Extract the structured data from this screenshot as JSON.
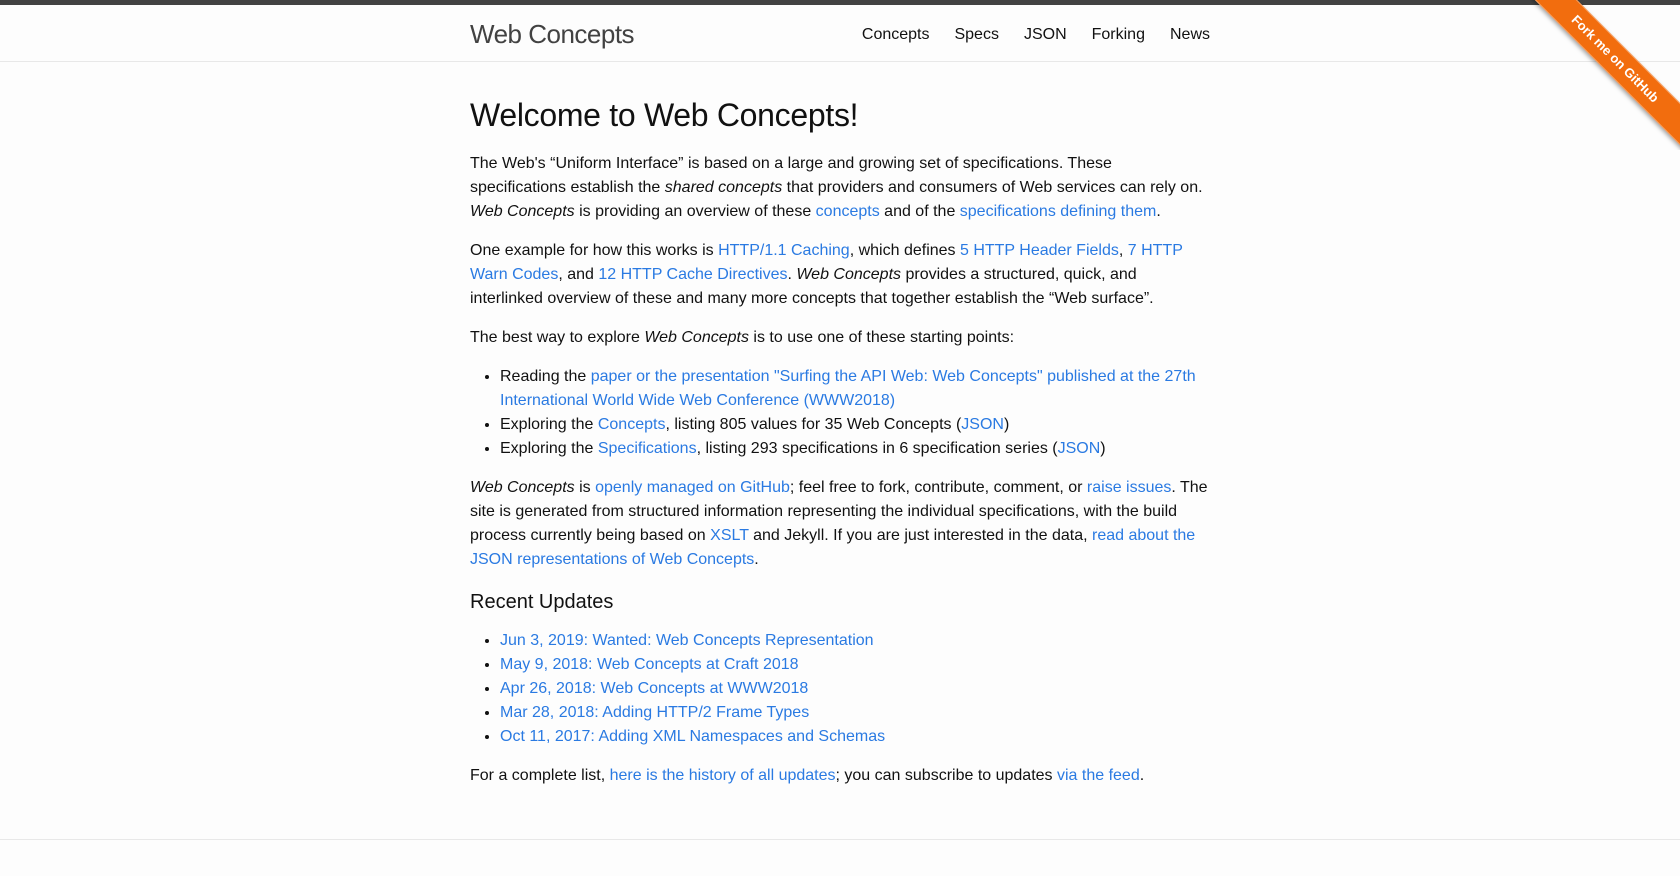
{
  "header": {
    "site_title": "Web Concepts",
    "nav": [
      "Concepts",
      "Specs",
      "JSON",
      "Forking",
      "News"
    ]
  },
  "ribbon": "Fork me on GitHub",
  "main": {
    "title": "Welcome to Web Concepts!",
    "intro": {
      "t1": "The Web's “Uniform Interface” is based on a large and growing set of specifications. These specifications establish the ",
      "em1": "shared concepts",
      "t2": " that providers and consumers of Web services can rely on. ",
      "em2": "Web Concepts",
      "t3": " is providing an overview of these ",
      "link1": "concepts",
      "t4": " and of the ",
      "link2": "specifications defining them",
      "t5": "."
    },
    "example": {
      "t1": "One example for how this works is ",
      "link1": "HTTP/1.1 Caching",
      "t2": ", which defines ",
      "link2": "5 HTTP Header Fields",
      "t3": ", ",
      "link3": "7 HTTP Warn Codes",
      "t4": ", and ",
      "link4": "12 HTTP Cache Directives",
      "t5": ". ",
      "em1": "Web Concepts",
      "t6": " provides a structured, quick, and interlinked overview of these and many more concepts that together establish the “Web surface”."
    },
    "explore": {
      "t1": "The best way to explore ",
      "em1": "Web Concepts",
      "t2": " is to use one of these starting points:"
    },
    "starting_points": [
      {
        "pre": "Reading the ",
        "link": "paper or the presentation \"Surfing the API Web: Web Concepts\" published at the 27th International World Wide Web Conference (WWW2018)"
      },
      {
        "pre": "Exploring the ",
        "link": "Concepts",
        "mid": ", listing 805 values for 35 Web Concepts (",
        "link2": "JSON",
        "post": ")"
      },
      {
        "pre": "Exploring the ",
        "link": "Specifications",
        "mid": ", listing 293 specifications in 6 specification series (",
        "link2": "JSON",
        "post": ")"
      }
    ],
    "github": {
      "em1": "Web Concepts",
      "t1": " is ",
      "link1": "openly managed on GitHub",
      "t2": "; feel free to fork, contribute, comment, or ",
      "link2": "raise issues",
      "t3": ". The site is generated from structured information representing the individual specifications, with the build process currently being based on ",
      "link3": "XSLT",
      "t4": " and Jekyll. If you are just interested in the data, ",
      "link4": "read about the JSON representations of Web Concepts",
      "t5": "."
    },
    "updates_title": "Recent Updates",
    "updates": [
      "Jun 3, 2019: Wanted: Web Concepts Representation",
      "May 9, 2018: Web Concepts at Craft 2018",
      "Apr 26, 2018: Web Concepts at WWW2018",
      "Mar 28, 2018: Adding HTTP/2 Frame Types",
      "Oct 11, 2017: Adding XML Namespaces and Schemas"
    ],
    "complete": {
      "t1": "For a complete list, ",
      "link1": "here is the history of all updates",
      "t2": "; you can subscribe to updates ",
      "link2": "via the feed",
      "t3": "."
    }
  }
}
